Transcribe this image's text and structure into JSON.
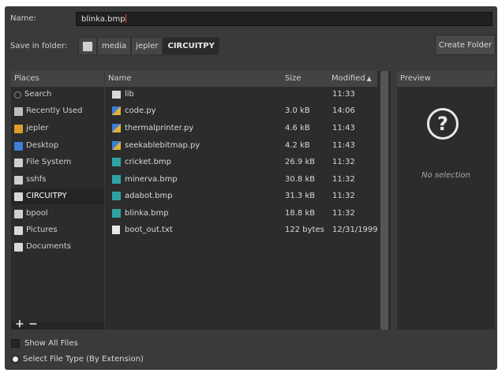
{
  "dialog": {
    "name_label": "Name:",
    "name_value": "blinka.bmp",
    "save_in_label": "Save in folder:",
    "path": [
      "media",
      "jepler",
      "CIRCUITPY"
    ],
    "create_folder_label": "Create Folder"
  },
  "places": {
    "header": "Places",
    "items": [
      {
        "label": "Search",
        "icon": "search-icon"
      },
      {
        "label": "Recently Used",
        "icon": "recent-icon"
      },
      {
        "label": "jepler",
        "icon": "home-icon"
      },
      {
        "label": "Desktop",
        "icon": "desktop-icon"
      },
      {
        "label": "File System",
        "icon": "drive-icon"
      },
      {
        "label": "sshfs",
        "icon": "network-icon"
      },
      {
        "label": "CIRCUITPY",
        "icon": "drive-icon"
      },
      {
        "label": "bpool",
        "icon": "drive-icon"
      },
      {
        "label": "Pictures",
        "icon": "folder-icon"
      },
      {
        "label": "Documents",
        "icon": "folder-icon"
      }
    ],
    "selected": "CIRCUITPY",
    "add_label": "+",
    "remove_label": "−"
  },
  "files": {
    "headers": {
      "name": "Name",
      "size": "Size",
      "modified": "Modified"
    },
    "rows": [
      {
        "name": "lib",
        "size": "",
        "modified": "11:33",
        "icon": "folder-icon"
      },
      {
        "name": "code.py",
        "size": "3.0 kB",
        "modified": "14:06",
        "icon": "python-file-icon"
      },
      {
        "name": "thermalprinter.py",
        "size": "4.6 kB",
        "modified": "11:43",
        "icon": "python-file-icon"
      },
      {
        "name": "seekablebitmap.py",
        "size": "4.2 kB",
        "modified": "11:43",
        "icon": "python-file-icon"
      },
      {
        "name": "cricket.bmp",
        "size": "26.9 kB",
        "modified": "11:32",
        "icon": "image-file-icon"
      },
      {
        "name": "minerva.bmp",
        "size": "30.8 kB",
        "modified": "11:32",
        "icon": "image-file-icon"
      },
      {
        "name": "adabot.bmp",
        "size": "31.3 kB",
        "modified": "11:32",
        "icon": "image-file-icon"
      },
      {
        "name": "blinka.bmp",
        "size": "18.8 kB",
        "modified": "11:32",
        "icon": "image-file-icon"
      },
      {
        "name": "boot_out.txt",
        "size": "122 bytes",
        "modified": "12/31/1999",
        "icon": "text-file-icon"
      }
    ]
  },
  "preview": {
    "header": "Preview",
    "empty_label": "No selection"
  },
  "footer": {
    "show_all_label": "Show All Files",
    "file_type_label": "Select File Type (By Extension)"
  },
  "colors": {
    "accent": "#3d7fd6",
    "folder": "#d9d9d9",
    "python": "#e2b13c",
    "image": "#2fa3a3"
  }
}
